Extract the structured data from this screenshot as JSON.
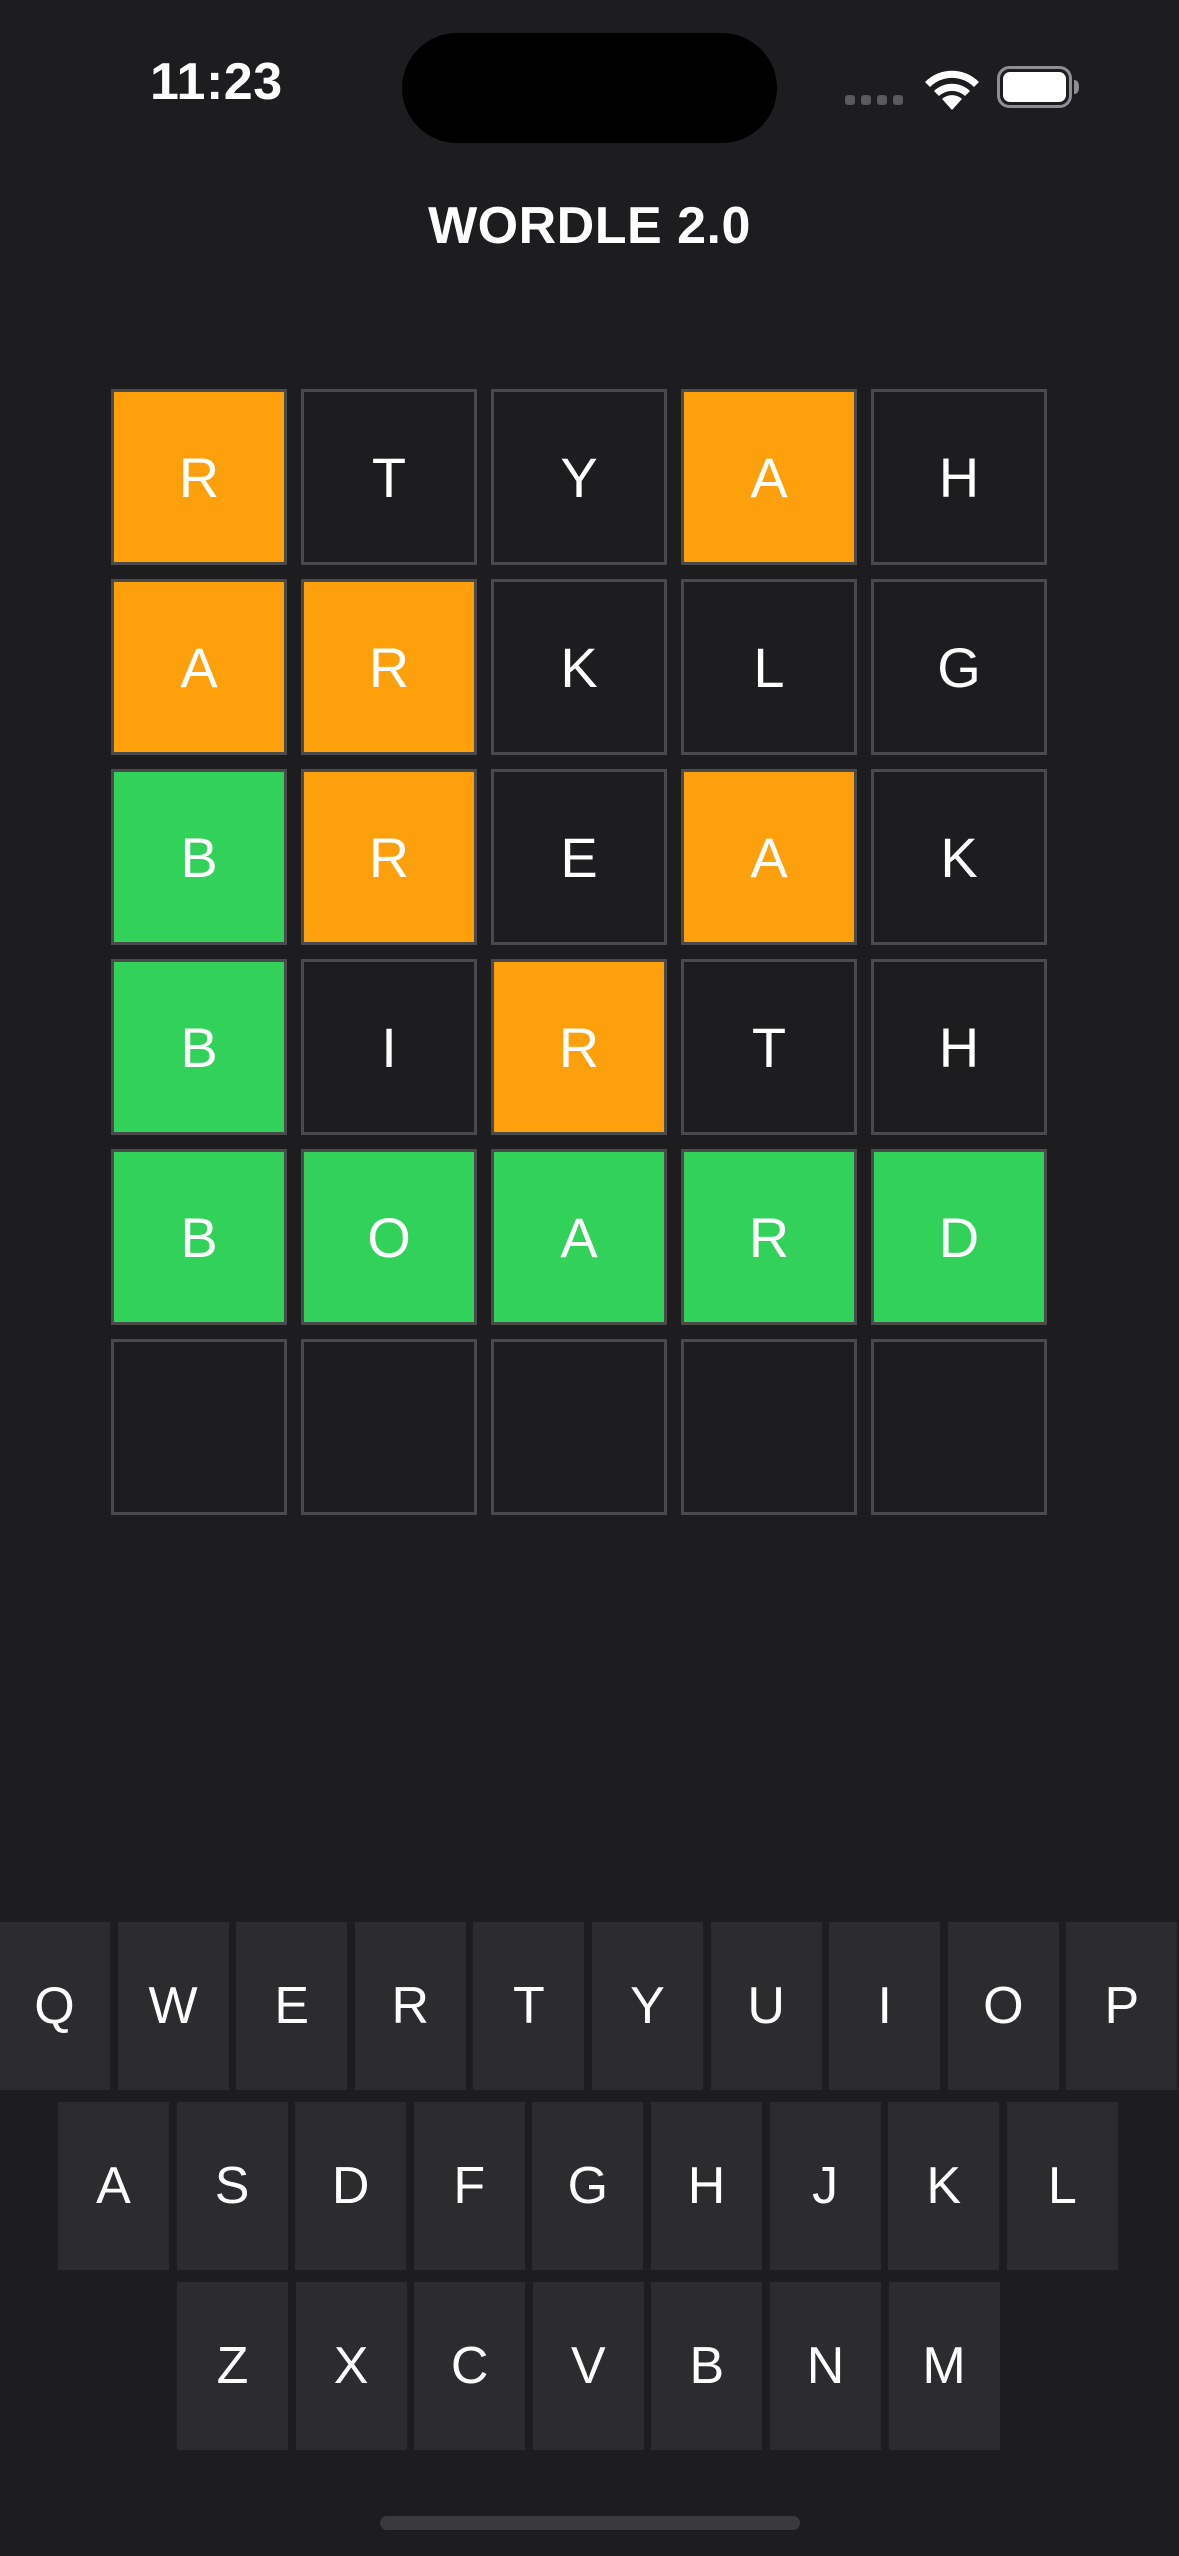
{
  "status_bar": {
    "time": "11:23"
  },
  "app": {
    "title": "WORDLE 2.0"
  },
  "board": {
    "rows": [
      {
        "tiles": [
          {
            "letter": "R",
            "state": "present"
          },
          {
            "letter": "T",
            "state": "absent"
          },
          {
            "letter": "Y",
            "state": "absent"
          },
          {
            "letter": "A",
            "state": "present"
          },
          {
            "letter": "H",
            "state": "absent"
          }
        ]
      },
      {
        "tiles": [
          {
            "letter": "A",
            "state": "present"
          },
          {
            "letter": "R",
            "state": "present"
          },
          {
            "letter": "K",
            "state": "absent"
          },
          {
            "letter": "L",
            "state": "absent"
          },
          {
            "letter": "G",
            "state": "absent"
          }
        ]
      },
      {
        "tiles": [
          {
            "letter": "B",
            "state": "correct"
          },
          {
            "letter": "R",
            "state": "present"
          },
          {
            "letter": "E",
            "state": "absent"
          },
          {
            "letter": "A",
            "state": "present"
          },
          {
            "letter": "K",
            "state": "absent"
          }
        ]
      },
      {
        "tiles": [
          {
            "letter": "B",
            "state": "correct"
          },
          {
            "letter": "I",
            "state": "absent"
          },
          {
            "letter": "R",
            "state": "present"
          },
          {
            "letter": "T",
            "state": "absent"
          },
          {
            "letter": "H",
            "state": "absent"
          }
        ]
      },
      {
        "tiles": [
          {
            "letter": "B",
            "state": "correct"
          },
          {
            "letter": "O",
            "state": "correct"
          },
          {
            "letter": "A",
            "state": "correct"
          },
          {
            "letter": "R",
            "state": "correct"
          },
          {
            "letter": "D",
            "state": "correct"
          }
        ]
      },
      {
        "tiles": [
          {
            "letter": "",
            "state": "empty"
          },
          {
            "letter": "",
            "state": "empty"
          },
          {
            "letter": "",
            "state": "empty"
          },
          {
            "letter": "",
            "state": "empty"
          },
          {
            "letter": "",
            "state": "empty"
          }
        ]
      }
    ]
  },
  "keyboard": {
    "rows": [
      [
        "Q",
        "W",
        "E",
        "R",
        "T",
        "Y",
        "U",
        "I",
        "O",
        "P"
      ],
      [
        "A",
        "S",
        "D",
        "F",
        "G",
        "H",
        "J",
        "K",
        "L"
      ],
      [
        "Z",
        "X",
        "C",
        "V",
        "B",
        "N",
        "M"
      ]
    ]
  },
  "colors": {
    "background": "#1d1d1f",
    "present": "#fe9f0c",
    "correct": "#32d15a",
    "absent": "#1d1d1f",
    "tile_border": "#4a4a4d",
    "key": "#2c2c2e"
  },
  "icons": {
    "signal": "cellular-signal-icon",
    "wifi": "wifi-icon",
    "battery": "battery-icon"
  }
}
